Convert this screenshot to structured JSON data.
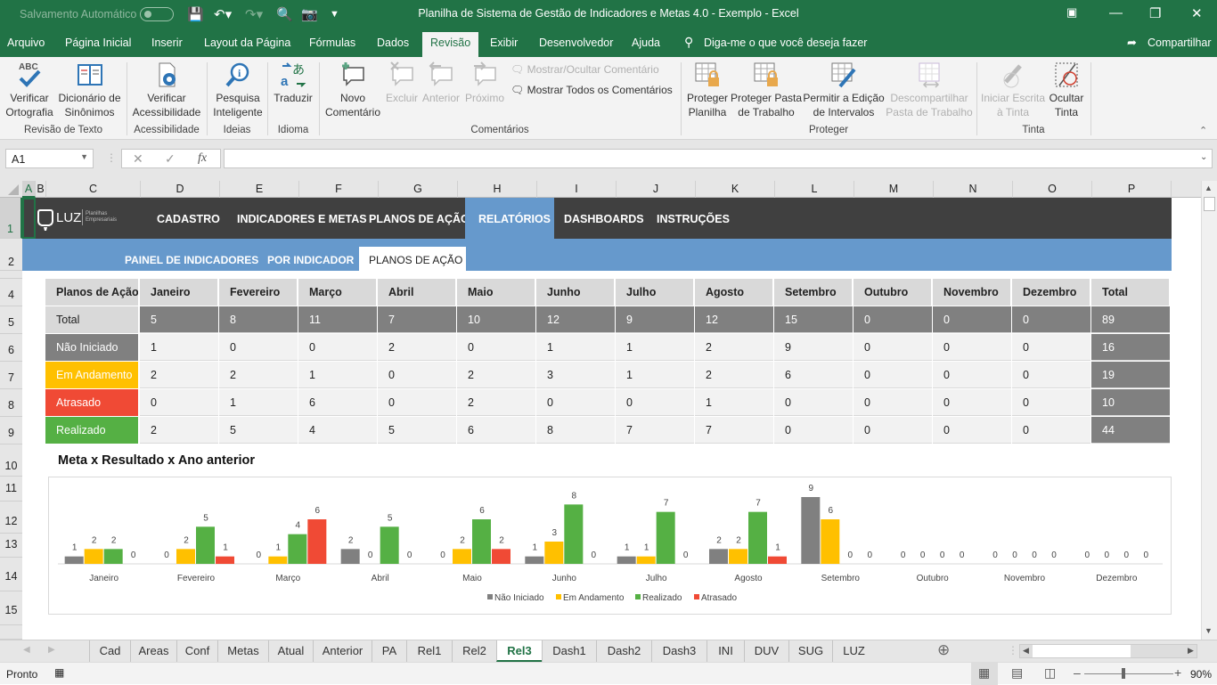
{
  "titlebar": {
    "autosave_label": "Salvamento Automático",
    "title": "Planilha de Sistema de Gestão de Indicadores e Metas 4.0 - Exemplo  -  Excel"
  },
  "menu": {
    "items": [
      "Arquivo",
      "Página Inicial",
      "Inserir",
      "Layout da Página",
      "Fórmulas",
      "Dados",
      "Revisão",
      "Exibir",
      "Desenvolvedor",
      "Ajuda"
    ],
    "active": "Revisão",
    "search_placeholder": "Diga-me o que você deseja fazer",
    "share": "Compartilhar"
  },
  "ribbon": {
    "buttons": {
      "ortografia": "Verificar\nOrtografia",
      "sinonimos": "Dicionário de\nSinônimos",
      "acessibilidade": "Verificar\nAcessibilidade",
      "pesquisa": "Pesquisa\nInteligente",
      "traduzir": "Traduzir",
      "novo_comentario": "Novo\nComentário",
      "excluir": "Excluir",
      "anterior": "Anterior",
      "proximo": "Próximo",
      "mostrar_ocultar": "Mostrar/Ocultar Comentário",
      "mostrar_todos": "Mostrar Todos os Comentários",
      "proteger_planilha": "Proteger\nPlanilha",
      "proteger_pasta": "Proteger Pasta\nde Trabalho",
      "permitir_edicao": "Permitir a Edição\nde Intervalos",
      "descompartilhar": "Descompartilhar\nPasta de Trabalho",
      "iniciar_escrita": "Iniciar Escrita\nà Tinta",
      "ocultar_tinta": "Ocultar\nTinta"
    },
    "groups": [
      "Revisão de Texto",
      "Acessibilidade",
      "Ideias",
      "Idioma",
      "Comentários",
      "Proteger",
      "Tinta"
    ]
  },
  "formula_bar": {
    "name_box": "A1",
    "fx": "fx",
    "value": ""
  },
  "columns": [
    "A",
    "B",
    "C",
    "D",
    "E",
    "F",
    "G",
    "H",
    "I",
    "J",
    "K",
    "L",
    "M",
    "N",
    "O",
    "P"
  ],
  "rows": [
    "1",
    "2",
    "4",
    "5",
    "6",
    "7",
    "8",
    "9",
    "10",
    "11",
    "12",
    "13",
    "14",
    "15"
  ],
  "nav": {
    "logo": "LUZ",
    "logo_sub": "Planilhas Empresariais",
    "items": [
      "CADASTRO",
      "INDICADORES E METAS",
      "PLANOS DE AÇÃO",
      "RELATÓRIOS",
      "DASHBOARDS",
      "INSTRUÇÕES"
    ],
    "active": "RELATÓRIOS",
    "sub_items": [
      "PAINEL DE INDICADORES",
      "POR INDICADOR",
      "PLANOS DE AÇÃO"
    ],
    "sub_active": "PLANOS DE AÇÃO"
  },
  "table": {
    "header": [
      "Planos de Ação",
      "Janeiro",
      "Fevereiro",
      "Março",
      "Abril",
      "Maio",
      "Junho",
      "Julho",
      "Agosto",
      "Setembro",
      "Outubro",
      "Novembro",
      "Dezembro",
      "Total"
    ],
    "rows": [
      {
        "label": "Total",
        "color": "#d9d9d9",
        "values": [
          "5",
          "8",
          "11",
          "7",
          "10",
          "12",
          "9",
          "12",
          "15",
          "0",
          "0",
          "0",
          "89"
        ]
      },
      {
        "label": "Não Iniciado",
        "color": "#808080",
        "values": [
          "1",
          "0",
          "0",
          "2",
          "0",
          "1",
          "1",
          "2",
          "9",
          "0",
          "0",
          "0",
          "16"
        ]
      },
      {
        "label": "Em Andamento",
        "color": "#ffc000",
        "values": [
          "2",
          "2",
          "1",
          "0",
          "2",
          "3",
          "1",
          "2",
          "6",
          "0",
          "0",
          "0",
          "19"
        ]
      },
      {
        "label": "Atrasado",
        "color": "#f04a35",
        "values": [
          "0",
          "1",
          "6",
          "0",
          "2",
          "0",
          "0",
          "1",
          "0",
          "0",
          "0",
          "0",
          "10"
        ]
      },
      {
        "label": "Realizado",
        "color": "#55b044",
        "values": [
          "2",
          "5",
          "4",
          "5",
          "6",
          "8",
          "7",
          "7",
          "0",
          "0",
          "0",
          "0",
          "44"
        ]
      }
    ]
  },
  "chart_title": "Meta x Resultado x Ano anterior",
  "chart_data": {
    "type": "bar",
    "title": "Meta x Resultado x Ano anterior",
    "categories": [
      "Janeiro",
      "Fevereiro",
      "Março",
      "Abril",
      "Maio",
      "Junho",
      "Julho",
      "Agosto",
      "Setembro",
      "Outubro",
      "Novembro",
      "Dezembro"
    ],
    "series": [
      {
        "name": "Não Iniciado",
        "color": "#808080",
        "values": [
          1,
          0,
          0,
          2,
          0,
          1,
          1,
          2,
          9,
          0,
          0,
          0
        ]
      },
      {
        "name": "Em Andamento",
        "color": "#ffc000",
        "values": [
          2,
          2,
          1,
          0,
          2,
          3,
          1,
          2,
          6,
          0,
          0,
          0
        ]
      },
      {
        "name": "Realizado",
        "color": "#55b044",
        "values": [
          2,
          5,
          4,
          5,
          6,
          8,
          7,
          7,
          0,
          0,
          0,
          0
        ]
      },
      {
        "name": "Atrasado",
        "color": "#f04a35",
        "values": [
          0,
          1,
          6,
          0,
          2,
          0,
          0,
          1,
          0,
          0,
          0,
          0
        ]
      }
    ],
    "xlabel": "",
    "ylabel": "",
    "ylim": [
      0,
      9
    ],
    "grid": false,
    "data_labels": true,
    "legend": "bottom"
  },
  "sheet_tabs": [
    "Cad",
    "Areas",
    "Conf",
    "Metas",
    "Atual",
    "Anterior",
    "PA",
    "Rel1",
    "Rel2",
    "Rel3",
    "Dash1",
    "Dash2",
    "Dash3",
    "INI",
    "DUV",
    "SUG",
    "LUZ"
  ],
  "active_sheet": "Rel3",
  "status": {
    "ready": "Pronto",
    "zoom": "90%"
  }
}
